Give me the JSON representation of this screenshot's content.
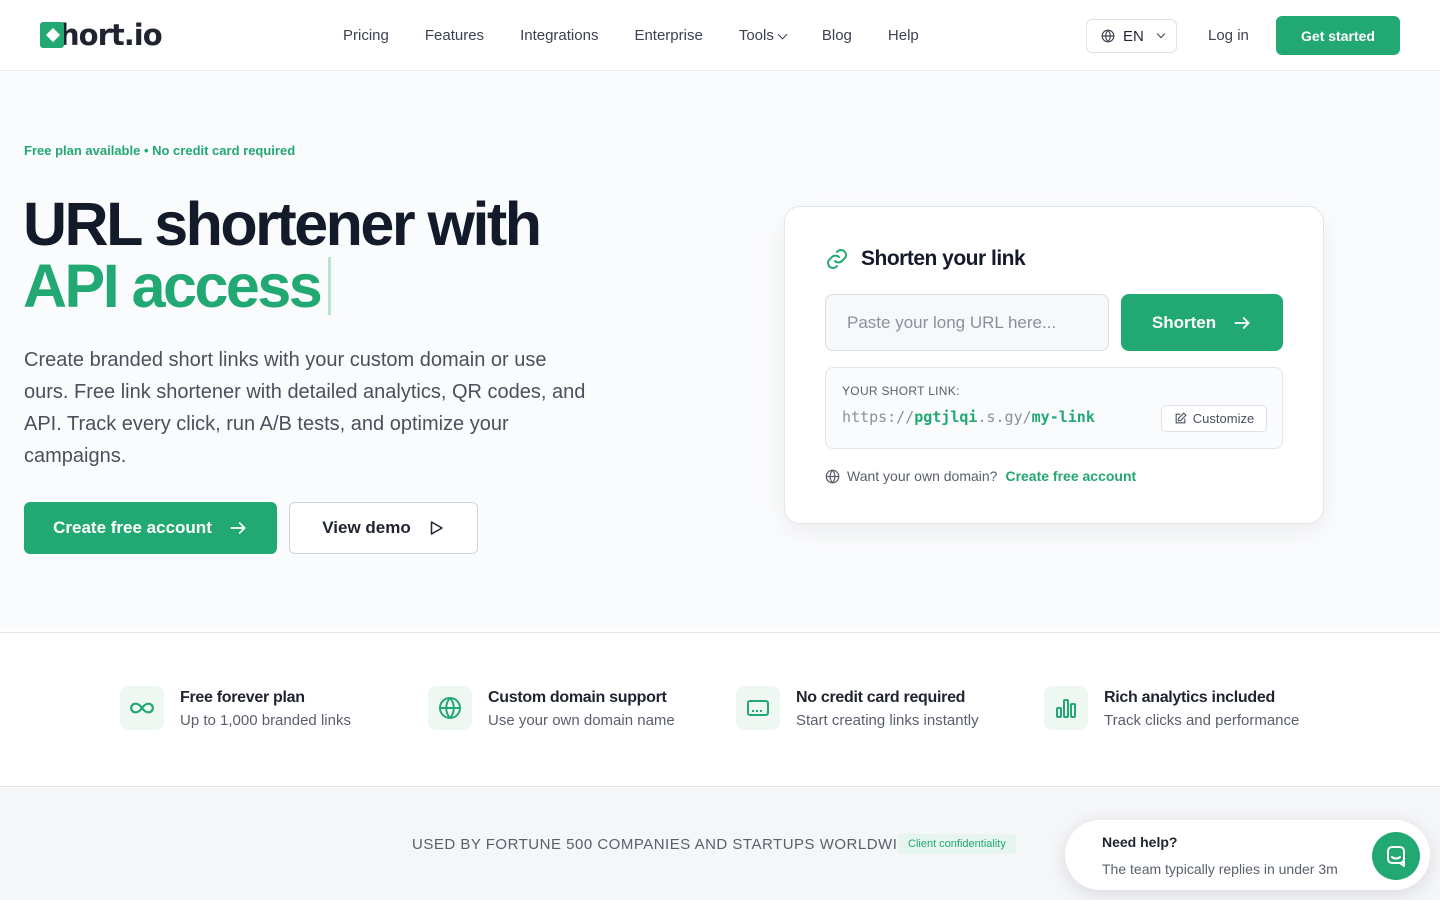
{
  "header": {
    "logo_text": "hort.io",
    "nav": [
      "Pricing",
      "Features",
      "Integrations",
      "Enterprise",
      "Tools",
      "Blog",
      "Help"
    ],
    "language": "EN",
    "login": "Log in",
    "get_started": "Get started"
  },
  "hero": {
    "eyebrow": "Free plan available • No credit card required",
    "title_line1": "URL shortener with",
    "title_line2": "API access",
    "subtitle": "Create branded short links with your custom domain or use ours. Free link shortener with detailed analytics, QR codes, and API. Track every click, run A/B tests, and optimize your campaigns.",
    "cta_primary": "Create free account",
    "cta_secondary": "View demo"
  },
  "card": {
    "title": "Shorten your link",
    "input_placeholder": "Paste your long URL here...",
    "shorten_label": "Shorten",
    "short_link_label": "YOUR SHORT LINK:",
    "short_url_scheme": "https://",
    "short_url_domain": "pgtjlqi",
    "short_url_tld": ".s.gy/",
    "short_url_slug": "my-link",
    "customize_label": "Customize",
    "own_domain_text": "Want your own domain?",
    "own_domain_link": "Create free account"
  },
  "features": [
    {
      "title": "Free forever plan",
      "desc": "Up to 1,000 branded links",
      "icon": "infinity-icon"
    },
    {
      "title": "Custom domain support",
      "desc": "Use your own domain name",
      "icon": "globe-icon"
    },
    {
      "title": "No credit card required",
      "desc": "Start creating links instantly",
      "icon": "credit-card-icon"
    },
    {
      "title": "Rich analytics included",
      "desc": "Track clicks and performance",
      "icon": "bar-chart-icon"
    }
  ],
  "trusted": {
    "text": "USED BY FORTUNE 500 COMPANIES AND STARTUPS WORLDWIDE",
    "badge": "Client confidentiality"
  },
  "chat": {
    "title": "Need help?",
    "subtitle": "The team typically replies in under 3m"
  },
  "colors": {
    "brand": "#22a872",
    "heading": "#131a2a"
  }
}
